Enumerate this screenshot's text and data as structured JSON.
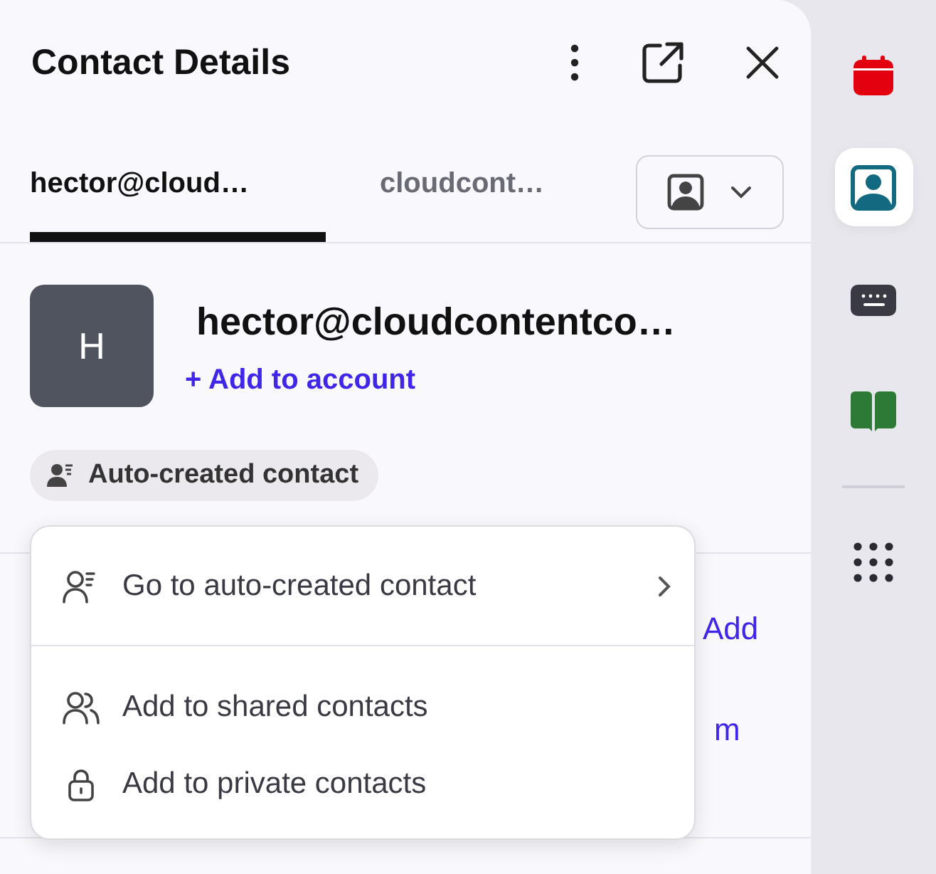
{
  "panel": {
    "title": "Contact Details"
  },
  "tabs": [
    {
      "label": "hector@cloud…",
      "selected": true
    },
    {
      "label": "cloudcont…",
      "selected": false
    }
  ],
  "contact": {
    "initial": "H",
    "name": "hector@cloudcontentco…",
    "add_link": "+ Add to account",
    "badge": "Auto-created contact"
  },
  "background_fragments": [
    {
      "text": "Add"
    },
    {
      "text": "m"
    }
  ],
  "menu": [
    {
      "label": "Go to auto-created contact",
      "kind": "auto",
      "submenu": true
    },
    {
      "label": "Add to shared contacts",
      "kind": "shared",
      "submenu": false
    },
    {
      "label": "Add to private contacts",
      "kind": "lock",
      "submenu": false
    }
  ],
  "sidebar": [
    {
      "kind": "calendar",
      "selected": false
    },
    {
      "kind": "contacts",
      "selected": true
    },
    {
      "kind": "keyboard",
      "selected": false
    },
    {
      "kind": "book",
      "selected": false
    },
    {
      "kind": "divider"
    },
    {
      "kind": "apps",
      "selected": false
    }
  ]
}
